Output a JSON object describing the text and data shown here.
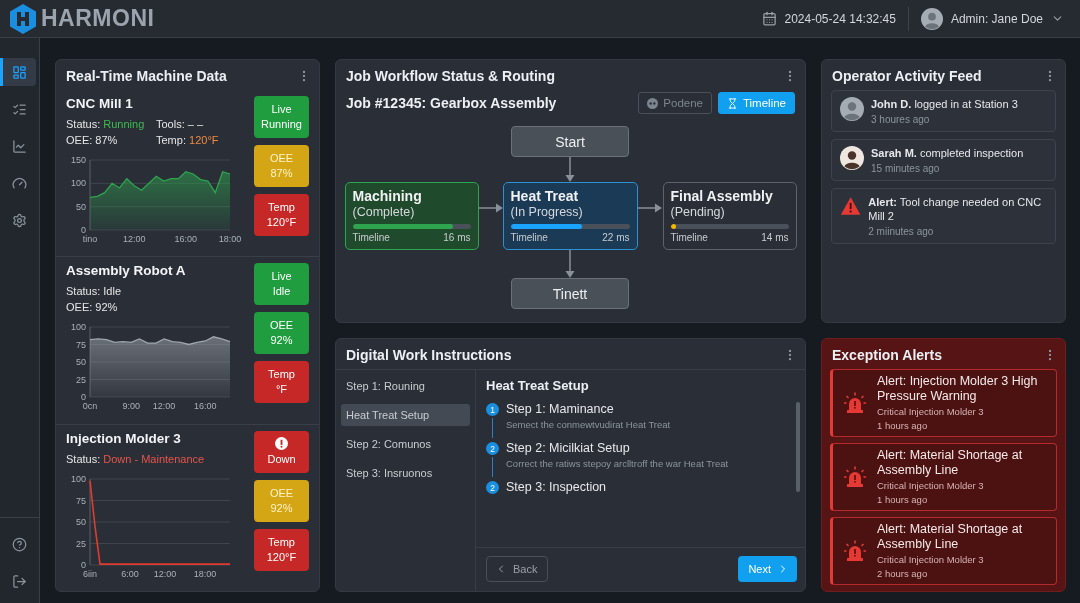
{
  "header": {
    "logo": "HARMONI",
    "datetime": "2024-05-24 14:32:45",
    "user": "Admin: Jane Doe"
  },
  "sidebar": {
    "items": [
      {
        "selected": true
      },
      {
        "selected": false
      },
      {
        "selected": false
      },
      {
        "selected": false
      },
      {
        "selected": false
      }
    ]
  },
  "machine_panel": {
    "title": "Real-Time Machine Data",
    "machines": [
      {
        "name": "CNC Mill 1",
        "stats": [
          [
            {
              "label": "Status:",
              "value": "Running",
              "color": "#3fb950"
            },
            {
              "label": "Tools:",
              "value": "– –",
              "color": "#e6e6e6"
            }
          ],
          [
            {
              "label": "OEE:",
              "value": "87%",
              "color": "#e6e6e6"
            },
            {
              "label": "Temp:",
              "value": "120°F",
              "color": "#f0883e"
            }
          ]
        ],
        "chart_data": {
          "type": "area",
          "grid": true,
          "categories": [
            "tino",
            null,
            null,
            null,
            null,
            null,
            "12:00",
            null,
            null,
            null,
            null,
            null,
            null,
            "16:00",
            null,
            null,
            null,
            null,
            null,
            "18:00"
          ],
          "ylim": [
            0,
            150
          ],
          "yticks": [
            0,
            50,
            100,
            150
          ],
          "series": [
            {
              "color": "#2ea44f",
              "values": [
                70,
                72,
                80,
                100,
                90,
                110,
                95,
                85,
                100,
                115,
                105,
                110,
                110,
                125,
                120,
                108,
                105,
                80,
                125,
                120
              ]
            }
          ]
        },
        "badges": [
          {
            "kind": "text",
            "lines": [
              "Live",
              "Running"
            ],
            "color": "#1f9d3f"
          },
          {
            "kind": "text",
            "lines": [
              "OEE",
              "87%"
            ],
            "color": "#d4a514"
          },
          {
            "kind": "text",
            "lines": [
              "Temp",
              "120°F"
            ],
            "color": "#c62828"
          }
        ]
      },
      {
        "name": "Assembly Robot A",
        "stats": [
          [
            {
              "label": "Status:",
              "value": "Idle",
              "color": "#e6e6e6"
            }
          ],
          [
            {
              "label": "OEE:",
              "value": "92%",
              "color": "#e6e6e6"
            }
          ]
        ],
        "chart_data": {
          "type": "area",
          "grid": true,
          "categories": [
            "0cn",
            null,
            null,
            null,
            null,
            "9:00",
            null,
            null,
            null,
            "12:00",
            null,
            null,
            null,
            null,
            "16:00",
            null,
            null,
            null
          ],
          "ylim": [
            0,
            100
          ],
          "yticks": [
            0,
            25,
            50,
            75,
            100
          ],
          "series": [
            {
              "color": "#a0a6ad",
              "values": [
                82,
                83,
                82,
                78,
                79,
                78,
                83,
                77,
                77,
                83,
                79,
                78,
                75,
                78,
                80,
                86,
                83,
                79
              ]
            }
          ]
        },
        "badges": [
          {
            "kind": "text",
            "lines": [
              "Live",
              "Idle"
            ],
            "color": "#1f9d3f"
          },
          {
            "kind": "text",
            "lines": [
              "OEE",
              "92%"
            ],
            "color": "#1f9d3f"
          },
          {
            "kind": "text",
            "lines": [
              "Temp",
              "°F"
            ],
            "color": "#c62828"
          }
        ]
      },
      {
        "name": "Injection Molder 3",
        "stats": [
          [
            {
              "label": "Status:",
              "value": "Down - Maintenance",
              "color": "#e5534b"
            }
          ]
        ],
        "chart_data": {
          "type": "line",
          "grid": true,
          "categories": [
            "6iin",
            null,
            null,
            null,
            null,
            null,
            null,
            null,
            "6:00",
            null,
            null,
            null,
            null,
            null,
            null,
            "12:00",
            null,
            null,
            null,
            null,
            null,
            null,
            null,
            "18:00",
            null,
            null,
            null,
            null,
            null
          ],
          "ylim": [
            0,
            100
          ],
          "yticks": [
            0,
            25,
            50,
            75,
            100
          ],
          "series": [
            {
              "color": "#e03b2f",
              "values": [
                98,
                45,
                1,
                1,
                1,
                1,
                1,
                1,
                1,
                1,
                1,
                1,
                1,
                1,
                1,
                1,
                1,
                1,
                1,
                1,
                1,
                1,
                1,
                1,
                1,
                1,
                1,
                1,
                1
              ]
            }
          ]
        },
        "badges": [
          {
            "kind": "alert",
            "lines": [
              "Down"
            ],
            "color": "#c62828"
          },
          {
            "kind": "text",
            "lines": [
              "OEE",
              "92%"
            ],
            "color": "#d4a514"
          },
          {
            "kind": "text",
            "lines": [
              "Temp",
              "120°F"
            ],
            "color": "#c62828"
          }
        ]
      }
    ]
  },
  "workflow": {
    "title": "Job Workflow Status & Routing",
    "job": "Job #12345: Gearbox Assembly",
    "views": [
      {
        "label": "Podene",
        "selected": false
      },
      {
        "label": "Timeline",
        "selected": true
      }
    ],
    "flow": {
      "start": "Start",
      "stages": [
        {
          "title": "Machining",
          "status": "(Complete)",
          "kind": "complete",
          "level": 0.85,
          "timeline_label": "Timeline",
          "duration": "16 ms"
        },
        {
          "title": "Heat Treat",
          "status": "(In Progress)",
          "kind": "active",
          "level": 0.6,
          "timeline_label": "Timeline",
          "duration": "22 ms"
        },
        {
          "title": "Final Assembly",
          "status": "(Pending)",
          "kind": "pending",
          "level": 0.02,
          "timeline_label": "Timeline",
          "duration": "14 ms"
        }
      ],
      "end": "Tinett"
    }
  },
  "activity": {
    "title": "Operator Activity Feed",
    "items": [
      {
        "kind": "user",
        "text": "**John D.** logged in at Station 3",
        "time": "3 houres ago"
      },
      {
        "kind": "photo",
        "text": "**Sarah M.** completed inspection",
        "time": "15 minutes ago"
      },
      {
        "kind": "alert",
        "text": "**Alert:** Tool change needed on CNC Mill 2",
        "time": "2 miinutes ago"
      }
    ]
  },
  "instructions": {
    "title": "Digital Work Instructions",
    "nav": [
      {
        "label": "Step 1: Rouning",
        "selected": false
      },
      {
        "label": "Heat Treat Setup",
        "selected": true
      },
      {
        "label": "Step 2: Comunos",
        "selected": false
      },
      {
        "label": "Step 3: Insruonos",
        "selected": false
      }
    ],
    "heading": "Heat Treat Setup",
    "steps": [
      {
        "number": "1",
        "title": "Step 1: Maminance",
        "description": "Semect the conmewtvudirat Heat Treat"
      },
      {
        "number": "2",
        "title": "Step 2: Micilkiat Setup",
        "description": "Correct the ratiws stepoy arclltroff the war Heat Treat"
      },
      {
        "number": "2",
        "title": "Step 3: Inspection"
      }
    ],
    "back": "Back",
    "next": "Next"
  },
  "alerts": {
    "title": "Exception Alerts",
    "items": [
      {
        "title": "Alert: Injection Molder 3 High Pressure Warning",
        "source": "Critical Injection Molder 3",
        "time": "1 hours ago"
      },
      {
        "title": "Alert: Material Shortage at Assembly Line",
        "source": "Critical Injection Molder 3",
        "time": "1 hours ago"
      },
      {
        "title": "Alert: Material Shortage at Assembly Line",
        "source": "Critical Injection Molder 3",
        "time": "2 hours ago"
      }
    ]
  }
}
